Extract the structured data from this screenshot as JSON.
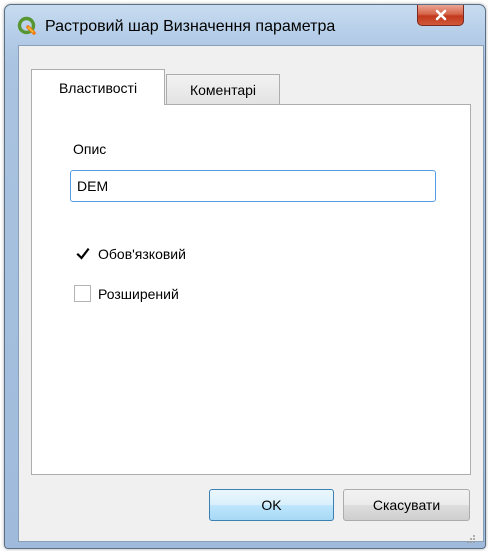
{
  "window": {
    "title": "Растровий шар Визначення параметра",
    "app_icon": "qgis-logo-icon",
    "close_icon": "close-icon"
  },
  "tabs": [
    {
      "label": "Властивості",
      "active": true
    },
    {
      "label": "Коментарі",
      "active": false
    }
  ],
  "form": {
    "description_label": "Опис",
    "description_value": "DEM",
    "mandatory": {
      "label": "Обов'язковий",
      "checked": true
    },
    "advanced": {
      "label": "Розширений",
      "checked": false
    }
  },
  "buttons": {
    "ok_label": "OK",
    "cancel_label": "Скасувати"
  },
  "colors": {
    "accent_focus": "#569de5",
    "close_red": "#c2391c",
    "qgis_green": "#589632",
    "qgis_yellow": "#ee7913"
  }
}
